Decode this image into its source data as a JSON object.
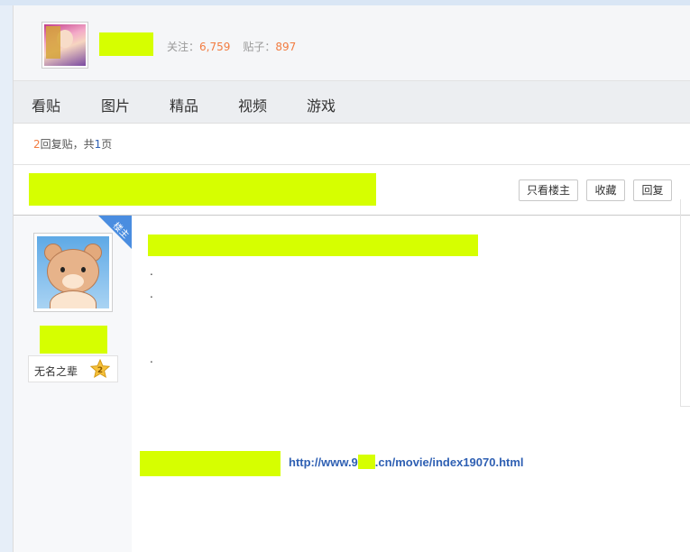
{
  "forum": {
    "name_tail": "",
    "follow_label": "关注：",
    "follow_count": "6,759",
    "posts_label": "贴子：",
    "posts_count": "897"
  },
  "tabs": [
    "看贴",
    "图片",
    "精品",
    "视频",
    "游戏"
  ],
  "reply_info": {
    "count": "2",
    "text1": "回复贴，共",
    "pages": "1",
    "text2": "页"
  },
  "thread": {
    "buttons": {
      "only_op": "只看楼主",
      "favorite": "收藏",
      "reply": "回复"
    }
  },
  "post": {
    "op_badge": "楼主",
    "author_level": "无名之辈",
    "level_number": "2",
    "dots": [
      ".",
      ".",
      "."
    ],
    "link_prefix": "http://www.9",
    "link_suffix": ".cn/movie/index19070.html"
  },
  "colors": {
    "accent": "#f27c41",
    "link": "#2f60b3",
    "redaction": "#d6ff00",
    "op_badge": "#4a8de0"
  }
}
